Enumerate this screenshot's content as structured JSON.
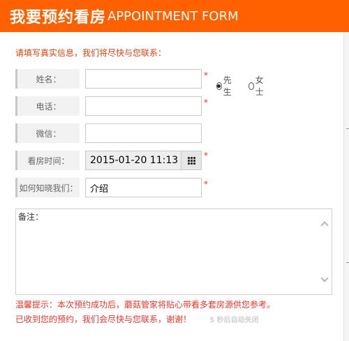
{
  "header": {
    "title_cn": "我要预约看房",
    "title_en": "APPOINTMENT FORM",
    "bg_color": "#ff6000"
  },
  "intro": "请填写真实信息，我们将尽快与您联系：",
  "fields": {
    "name": {
      "label": "姓名：",
      "value": "",
      "required": "*"
    },
    "phone": {
      "label": "电话：",
      "value": "",
      "required": "*"
    },
    "wechat": {
      "label": "微信：",
      "value": ""
    },
    "visit_time": {
      "label": "看房时间：",
      "value": "2015-01-20 11:13",
      "required": "*",
      "icon": "calendar-grid-icon"
    },
    "source": {
      "label": "如何知晓我们：",
      "value": "介绍",
      "required": "*"
    }
  },
  "gender": {
    "options": [
      "先生",
      "女士"
    ],
    "selected": "先生"
  },
  "remark": {
    "placeholder": "备注："
  },
  "footer": {
    "tip": "温馨提示：本次预约成功后，蘑菇管家将贴心带看多套房源供您参考。",
    "confirm": "已收到您的预约，我们会尽快与您联系，谢谢！",
    "countdown": "5 秒后自动关闭"
  },
  "colors": {
    "accent": "#ff6000",
    "required": "#e3362a",
    "intro_text": "#d5410c"
  }
}
